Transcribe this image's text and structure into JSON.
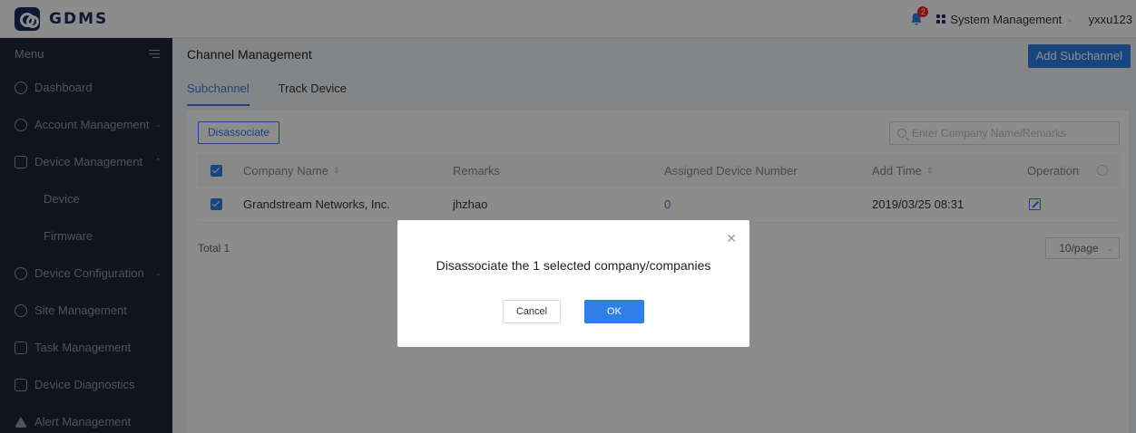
{
  "app": {
    "logo_text": "GDMS"
  },
  "header": {
    "notification_count": "2",
    "system_menu_label": "System Management",
    "username": "yxxu123"
  },
  "sidebar": {
    "menu_label": "Menu",
    "items": [
      {
        "label": "Dashboard",
        "icon": "dashboard-icon"
      },
      {
        "label": "Account Management",
        "icon": "user-icon"
      },
      {
        "label": "Device Management",
        "icon": "device-icon"
      },
      {
        "label": "Device",
        "sub": true
      },
      {
        "label": "Firmware",
        "sub": true
      },
      {
        "label": "Device Configuration",
        "icon": "gear-icon"
      },
      {
        "label": "Site Management",
        "icon": "site-icon"
      },
      {
        "label": "Task Management",
        "icon": "task-icon"
      },
      {
        "label": "Device Diagnostics",
        "icon": "diagnostics-icon"
      },
      {
        "label": "Alert Management",
        "icon": "alert-icon"
      }
    ]
  },
  "main": {
    "title": "Channel Management",
    "add_button": "Add Subchannel",
    "tabs": [
      {
        "label": "Subchannel",
        "active": true
      },
      {
        "label": "Track Device",
        "active": false
      }
    ],
    "disassociate_button": "Disassociate",
    "search_placeholder": "Enter Company Name/Remarks",
    "table": {
      "columns": [
        "Company Name",
        "Remarks",
        "Assigned Device Number",
        "Add Time",
        "Operation"
      ],
      "rows": [
        {
          "company": "Grandstream Networks, Inc.",
          "remarks": "jhzhao",
          "assigned": "0",
          "add_time": "2019/03/25 08:31"
        }
      ]
    },
    "total": "Total 1",
    "page_size": "10/page"
  },
  "modal": {
    "message": "Disassociate the 1 selected company/companies",
    "cancel": "Cancel",
    "ok": "OK"
  },
  "colors": {
    "primary": "#2f7fe6",
    "sidebar_bg": "#1c2539",
    "badge": "#f5222d"
  }
}
